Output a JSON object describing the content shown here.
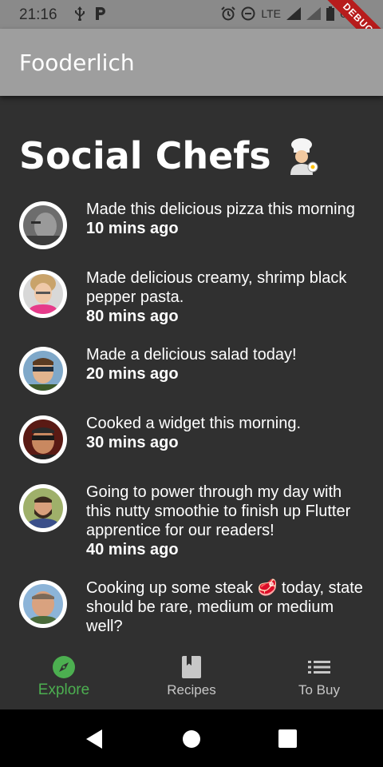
{
  "status": {
    "time": "21:16",
    "network": "LTE",
    "battery": "66%",
    "debug_label": "DEBUG"
  },
  "app_bar": {
    "title": "Fooderlich"
  },
  "page": {
    "title": "Social Chefs"
  },
  "feed": [
    {
      "text": "Made this delicious pizza this morning",
      "time": "10 mins ago"
    },
    {
      "text": "Made delicious creamy, shrimp black pepper pasta.",
      "time": "80 mins ago"
    },
    {
      "text": "Made a delicious salad today!",
      "time": "20 mins ago"
    },
    {
      "text": "Cooked a widget this morning.",
      "time": "30 mins ago"
    },
    {
      "text": "Going to power through my day with this nutty smoothie to finish up Flutter apprentice for our readers!",
      "time": "40 mins ago"
    },
    {
      "text": "Cooking up some steak 🥩 today, state should be rare, medium or medium well?",
      "time": ""
    }
  ],
  "bottom_nav": [
    {
      "label": "Explore",
      "icon": "compass-icon",
      "active": true
    },
    {
      "label": "Recipes",
      "icon": "book-icon",
      "active": false
    },
    {
      "label": "To Buy",
      "icon": "list-icon",
      "active": false
    }
  ],
  "colors": {
    "accent": "#4caf50",
    "app_bar": "#9e9e9e",
    "background": "#303030",
    "debug": "#b71c1c"
  }
}
